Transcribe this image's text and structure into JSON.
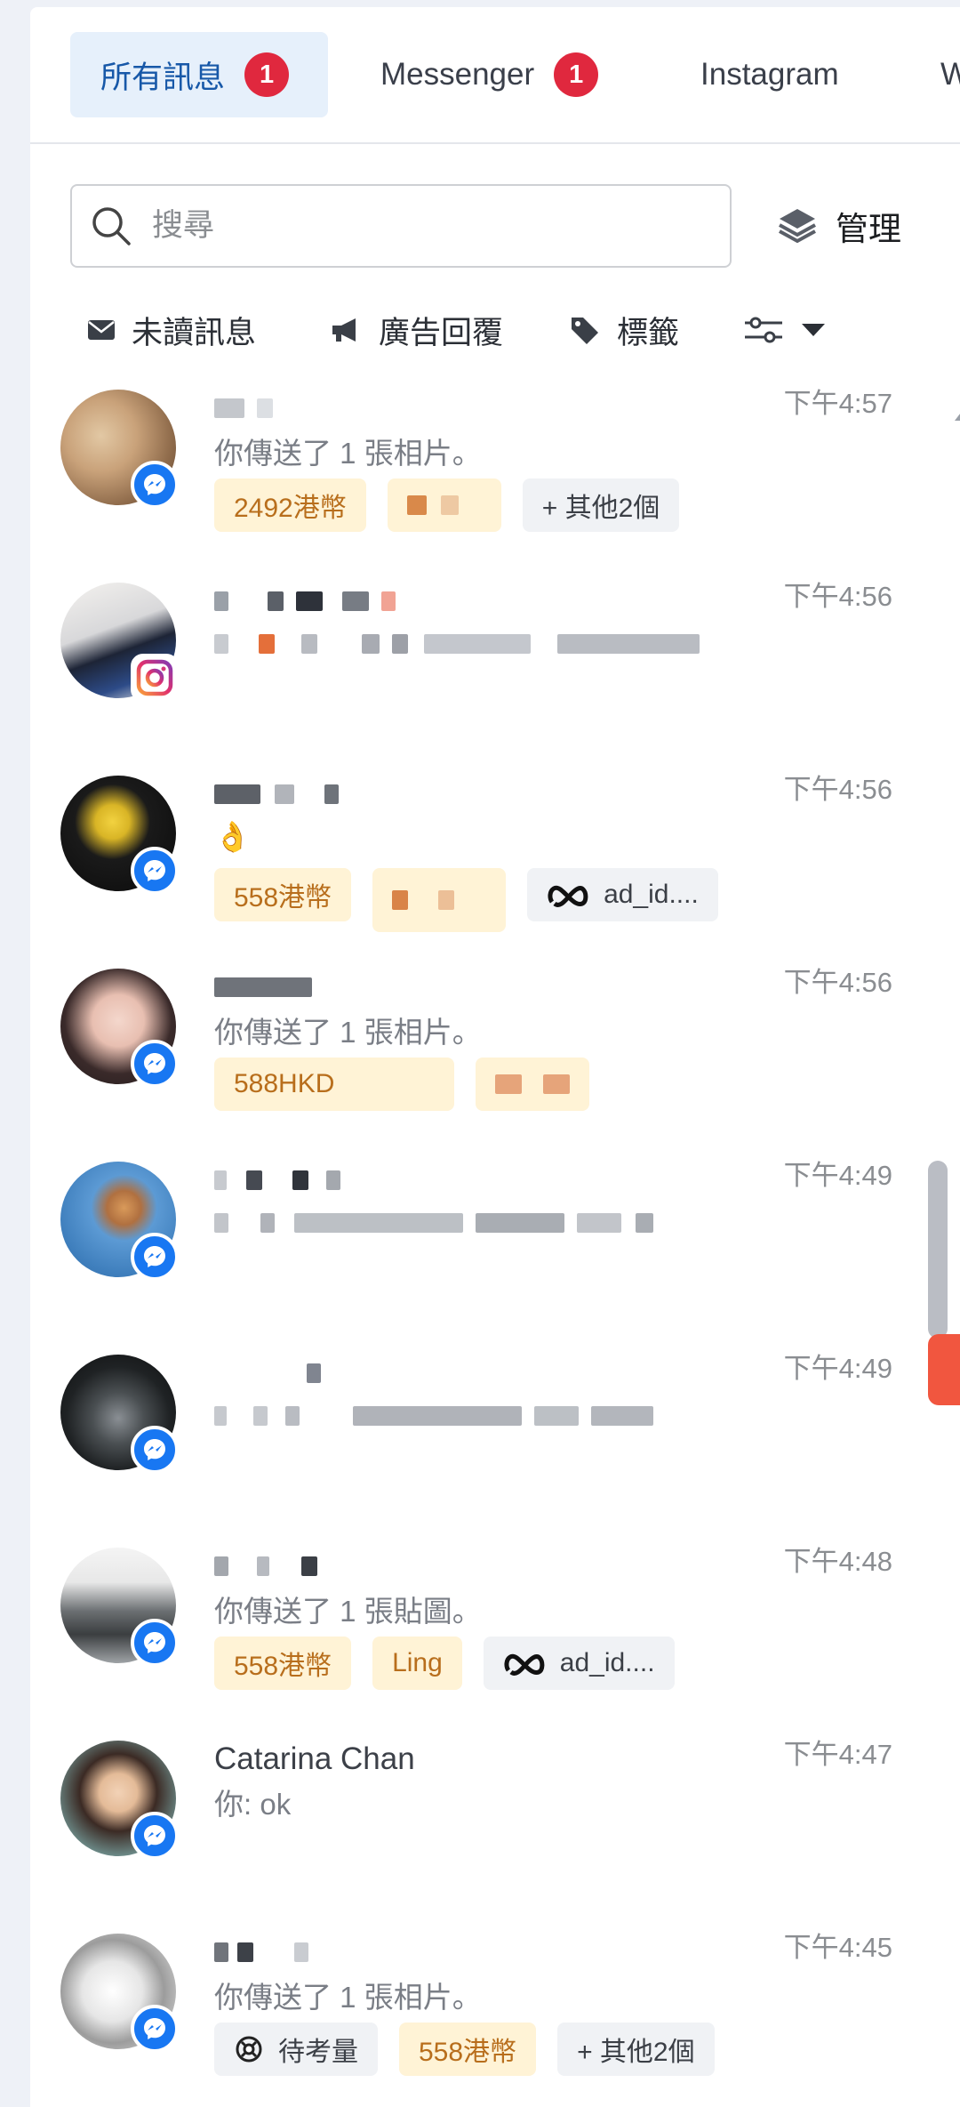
{
  "tabs": [
    {
      "label": "所有訊息",
      "badge": "1"
    },
    {
      "label": "Messenger",
      "badge": "1"
    },
    {
      "label": "Instagram",
      "badge": ""
    },
    {
      "label": "W",
      "badge": ""
    }
  ],
  "search": {
    "placeholder": "搜尋"
  },
  "manage_label": "管理",
  "filters": [
    {
      "label": "未讀訊息",
      "icon": "envelope-icon"
    },
    {
      "label": "廣告回覆",
      "icon": "megaphone-icon"
    },
    {
      "label": "標籤",
      "icon": "tag-icon"
    },
    {
      "label": "",
      "icon": "filter-sliders-icon"
    }
  ],
  "conversations": [
    {
      "name": "",
      "preview": "你傳送了 1 張相片。",
      "time": "下午4:57",
      "platform": "messenger",
      "chips": [
        {
          "label": "2492港幣",
          "style": "yellow"
        },
        {
          "label": "",
          "style": "yellow"
        },
        {
          "label": "+ 其他2個",
          "style": "grey"
        }
      ]
    },
    {
      "name": "",
      "preview": "",
      "time": "下午4:56",
      "platform": "instagram",
      "chips": []
    },
    {
      "name": "",
      "preview": "👌",
      "time": "下午4:56",
      "platform": "messenger",
      "chips": [
        {
          "label": "558港幣",
          "style": "yellow"
        },
        {
          "label": "",
          "style": "yellow"
        },
        {
          "label": "ad_id....",
          "style": "grey",
          "icon": "meta-icon"
        }
      ]
    },
    {
      "name": "",
      "preview": "你傳送了 1 張相片。",
      "time": "下午4:56",
      "platform": "messenger",
      "chips": [
        {
          "label": "588HKD",
          "style": "yellow"
        },
        {
          "label": "",
          "style": "yellow"
        }
      ]
    },
    {
      "name": "",
      "preview": "",
      "time": "下午4:49",
      "platform": "messenger",
      "chips": []
    },
    {
      "name": "",
      "preview": "",
      "time": "下午4:49",
      "platform": "messenger",
      "chips": []
    },
    {
      "name": "",
      "preview": "你傳送了 1 張貼圖。",
      "time": "下午4:48",
      "platform": "messenger",
      "chips": [
        {
          "label": "558港幣",
          "style": "yellow"
        },
        {
          "label": "Ling",
          "style": "yellow"
        },
        {
          "label": "ad_id....",
          "style": "grey",
          "icon": "meta-icon"
        }
      ]
    },
    {
      "name": "Catarina Chan",
      "preview": "你: ok",
      "time": "下午4:47",
      "platform": "messenger",
      "chips": []
    },
    {
      "name": "",
      "preview": "你傳送了 1 張相片。",
      "time": "下午4:45",
      "platform": "messenger",
      "chips": [
        {
          "label": "待考量",
          "style": "grey",
          "icon": "crm-icon"
        },
        {
          "label": "558港幣",
          "style": "yellow"
        },
        {
          "label": "+ 其他2個",
          "style": "grey"
        }
      ]
    }
  ],
  "colors": {
    "accent": "#1758a8",
    "badge": "#e0283e",
    "messenger": "#1877f2",
    "chip_yellow": "#fff3d6",
    "chip_yellow_text": "#b86e1c"
  }
}
